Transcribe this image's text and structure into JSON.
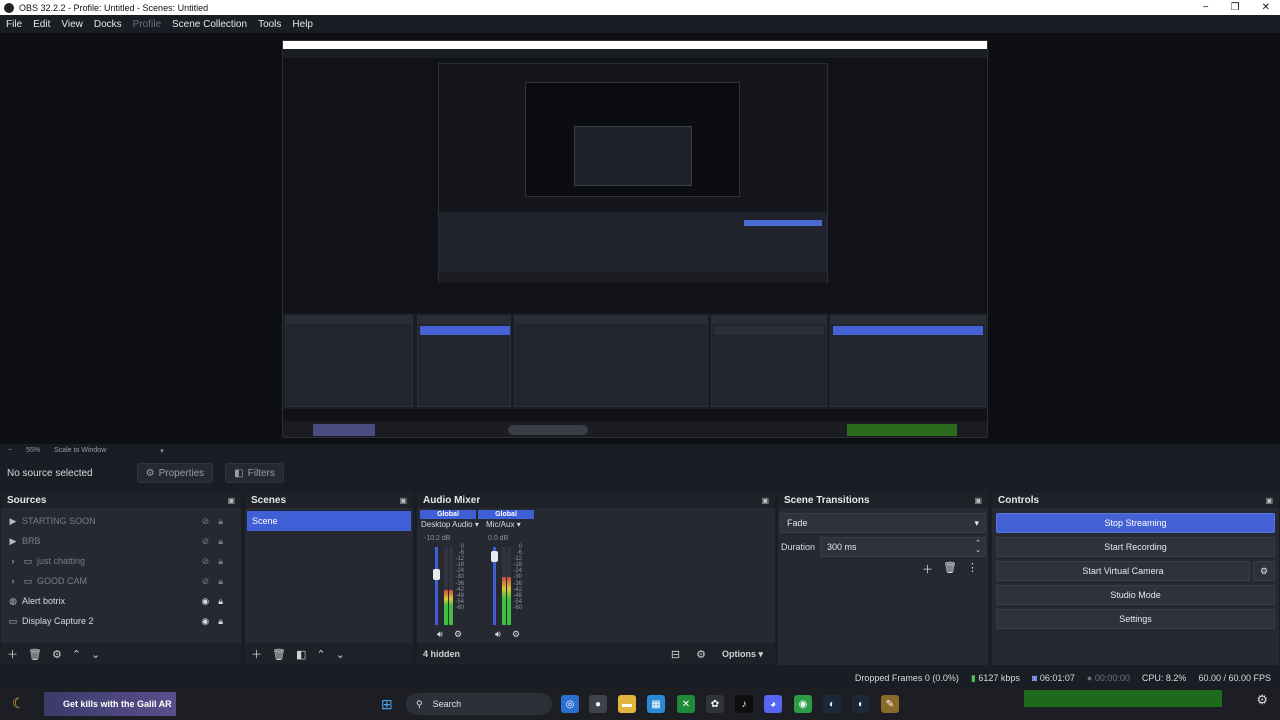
{
  "window": {
    "title": "OBS 32.2.2 - Profile: Untitled - Scenes: Untitled",
    "minimize": "−",
    "maximize": "❐",
    "close": "✕"
  },
  "menu": [
    "File",
    "Edit",
    "View",
    "Docks",
    "Profile",
    "Scene Collection",
    "Tools",
    "Help"
  ],
  "preview": {
    "zoom_minus": "−",
    "zoom_level": "55%",
    "scale_mode": "Scale to Window"
  },
  "source_bar": {
    "no_source": "No source selected",
    "properties": "Properties",
    "filters": "Filters"
  },
  "sources": {
    "title": "Sources",
    "items": [
      {
        "label": "STARTING SOON",
        "dim": true,
        "icon": "play-icon"
      },
      {
        "label": "BRB",
        "dim": true,
        "icon": "play-icon"
      },
      {
        "label": "just chatting",
        "dim": true,
        "icon": "folder-icon"
      },
      {
        "label": "GOOD CAM",
        "dim": true,
        "icon": "folder-icon"
      },
      {
        "label": "Alert botrix",
        "dim": false,
        "icon": "globe-icon"
      },
      {
        "label": "Display Capture 2",
        "dim": false,
        "icon": "monitor-icon"
      }
    ]
  },
  "scenes": {
    "title": "Scenes",
    "items": [
      "Scene"
    ]
  },
  "mixer": {
    "title": "Audio Mixer",
    "channels": [
      {
        "global": "Global",
        "name": "Desktop Audio",
        "db": "-10.2 dB",
        "level": 0.45
      },
      {
        "global": "Global",
        "name": "Mic/Aux",
        "db": "0.0 dB",
        "level": 0.62
      }
    ],
    "scale": [
      "0",
      "-6",
      "-12",
      "-18",
      "-24",
      "-30",
      "-36",
      "-42",
      "-48",
      "-54",
      "-60"
    ],
    "hidden": "4 hidden",
    "options": "Options"
  },
  "transitions": {
    "title": "Scene Transitions",
    "selected": "Fade",
    "duration_label": "Duration",
    "duration_value": "300 ms"
  },
  "controls": {
    "title": "Controls",
    "buttons": [
      "Stop Streaming",
      "Start Recording",
      "Start Virtual Camera",
      "Studio Mode",
      "Settings"
    ]
  },
  "status": {
    "dropped": "Dropped Frames 0 (0.0%)",
    "kbps": "6127 kbps",
    "stream_time": "06:01:07",
    "rec_time": "00:00:00",
    "cpu": "CPU: 8.2%",
    "fps": "60.00 / 60.00 FPS"
  },
  "taskbar": {
    "promo": "Get kills with the Galil AR",
    "search": "Search"
  },
  "colors": {
    "accent": "#4562d4",
    "background": "#1b1d24",
    "panel": "#262931"
  }
}
